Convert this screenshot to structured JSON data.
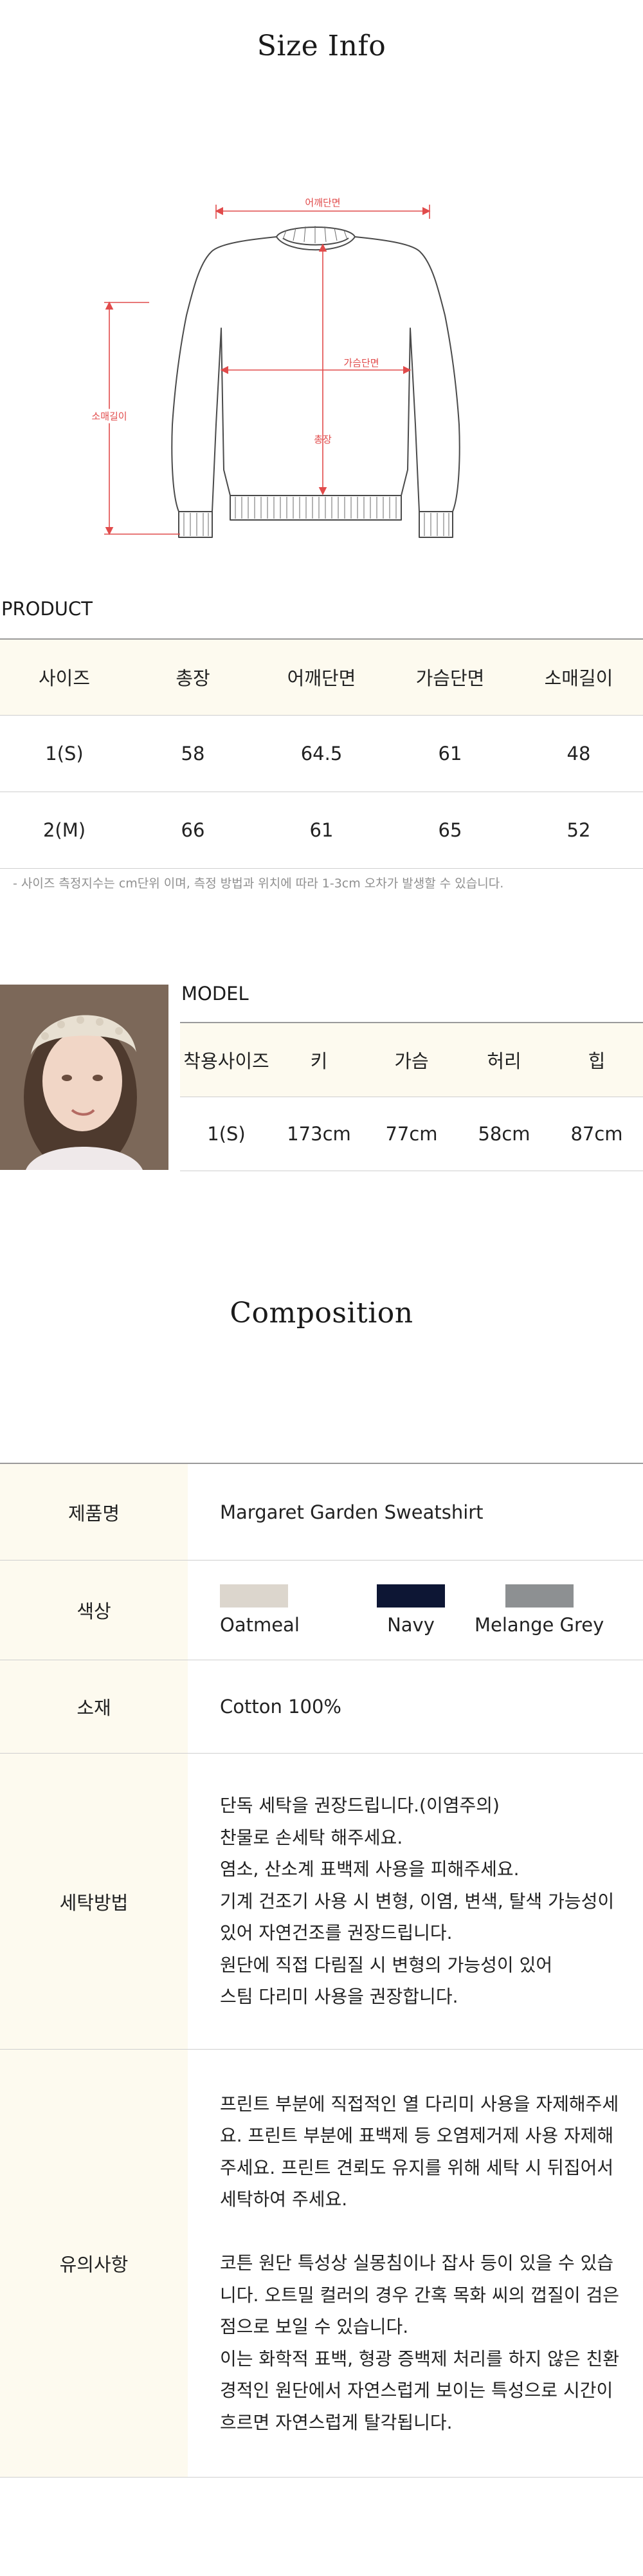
{
  "size_info": {
    "title": "Size Info",
    "diagram_labels": {
      "shoulder": "어깨단면",
      "chest": "가슴단면",
      "length": "총장",
      "sleeve": "소매길이"
    }
  },
  "product": {
    "label": "PRODUCT",
    "headers": [
      "사이즈",
      "총장",
      "어깨단면",
      "가슴단면",
      "소매길이"
    ],
    "rows": [
      [
        "1(S)",
        "58",
        "64.5",
        "61",
        "48"
      ],
      [
        "2(M)",
        "66",
        "61",
        "65",
        "52"
      ]
    ],
    "note": "-  사이즈 측정지수는 cm단위 이며, 측정 방법과 위치에 따라 1-3cm 오차가 발생할 수 있습니다."
  },
  "model": {
    "label": "MODEL",
    "headers": [
      "착용사이즈",
      "키",
      "가슴",
      "허리",
      "힙"
    ],
    "rows": [
      [
        "1(S)",
        "173cm",
        "77cm",
        "58cm",
        "87cm"
      ]
    ]
  },
  "composition": {
    "title": "Composition",
    "rows": {
      "product_name": {
        "key": "제품명",
        "value": "Margaret Garden Sweatshirt"
      },
      "color": {
        "key": "색상",
        "swatches": [
          {
            "name": "Oatmeal",
            "color": "#dcd6cd"
          },
          {
            "name": "Navy",
            "color": "#0d1634"
          },
          {
            "name": "Melange Grey",
            "color": "#8d9092"
          }
        ]
      },
      "material": {
        "key": "소재",
        "value": "Cotton 100%"
      },
      "washing": {
        "key": "세탁방법",
        "value": "단독 세탁을 권장드립니다.(이염주의)\n찬물로 손세탁 해주세요.\n염소, 산소계 표백제 사용을 피해주세요.\n기계 건조기 사용 시 변형, 이염, 변색, 탈색 가능성이\n있어 자연건조를 권장드립니다.\n원단에 직접 다림질 시 변형의 가능성이 있어\n스팀 다리미 사용을 권장합니다."
      },
      "caution": {
        "key": "유의사항",
        "value": "프린트 부분에 직접적인 열 다리미 사용을 자제해주세\n요. 프린트 부분에 표백제 등 오염제거제 사용 자제해\n주세요. 프린트 견뢰도 유지를 위해 세탁 시 뒤집어서\n세탁하여 주세요.\n\n코튼 원단 특성상 실몽침이나 잡사 등이 있을 수 있습\n니다. 오트밀 컬러의 경우 간혹 목화 씨의 껍질이 검은\n점으로 보일 수 있습니다.\n이는 화학적 표백, 형광 증백제 처리를 하지 않은 친환\n경적인 원단에서 자연스럽게 보이는 특성으로 시간이\n흐르면 자연스럽게 탈각됩니다."
      }
    }
  }
}
